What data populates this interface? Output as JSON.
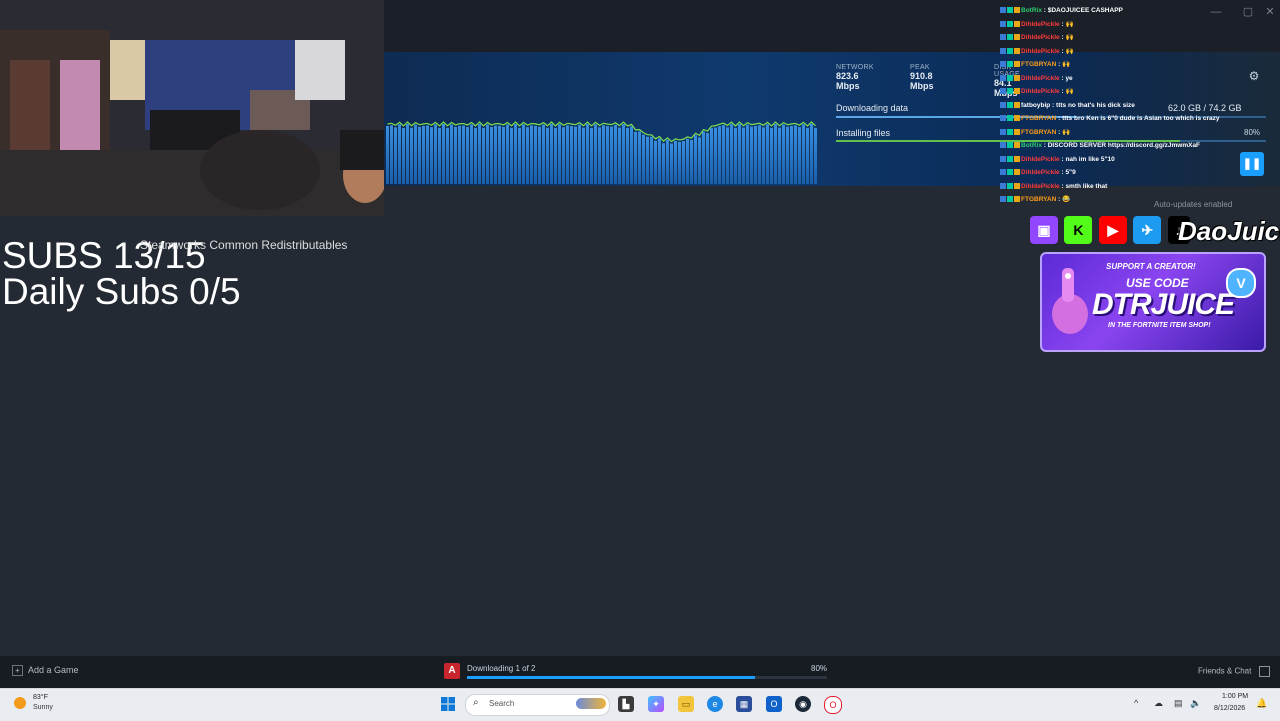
{
  "steam": {
    "network_label": "NETWORK",
    "network_value": "823.6 Mbps",
    "peak_label": "PEAK",
    "peak_value": "910.8 Mbps",
    "disk_label": "DISK USAGE",
    "disk_value": "84.1 Mbps",
    "downloading_label": "Downloading data",
    "installing_label": "Installing files",
    "download_size": "62.0 GB / 74.2 GB",
    "install_percent": "80%",
    "install_progress": 0.8,
    "auto_updates": "Auto-updates enabled",
    "redistributables": "Steamworks Common Redistributables",
    "add_game": "Add a Game",
    "download_status": "Downloading 1 of 2",
    "download_percent": "80%",
    "download_progress": 0.8,
    "friends_chat": "Friends & Chat",
    "pause_icon": "pause-icon",
    "settings_icon": "gear-icon"
  },
  "overlay": {
    "subs": "SUBS 13/15",
    "daily_subs": "Daily Subs  0/5",
    "brand": "DaoJuice",
    "promo_line1": "SUPPORT A CREATOR!",
    "promo_line2": "USE CODE",
    "promo_code": "DTRJUICE",
    "promo_line3": "IN THE FORTNITE ITEM SHOP!"
  },
  "chat": [
    {
      "user": "BotRix",
      "color": "#2ecc71",
      "text": "$DAOJUICEE CASHAPP"
    },
    {
      "user": "DihldePickle",
      "color": "#ff3b3b",
      "text": "🙌"
    },
    {
      "user": "DihldePickle",
      "color": "#ff3b3b",
      "text": "🙌"
    },
    {
      "user": "DihldePickle",
      "color": "#ff3b3b",
      "text": "🙌"
    },
    {
      "user": "FTGBRYAN",
      "color": "#ff9f1a",
      "text": "🙌"
    },
    {
      "user": "DihldePickle",
      "color": "#ff3b3b",
      "text": "ye"
    },
    {
      "user": "DihldePickle",
      "color": "#ff3b3b",
      "text": "🙌"
    },
    {
      "user": "fatboybip",
      "color": "#ffffff",
      "text": "ttts no that's his dick size"
    },
    {
      "user": "FTGBRYAN",
      "color": "#ff9f1a",
      "text": "ttts bro Ken is 6\"0 dude is Asian too which is crazy"
    },
    {
      "user": "FTGBRYAN",
      "color": "#ff9f1a",
      "text": "🙌"
    },
    {
      "user": "BotRix",
      "color": "#2ecc71",
      "text": "DISCORD SERVER https://discord.gg/zJmwmXaF"
    },
    {
      "user": "DihldePickle",
      "color": "#ff3b3b",
      "text": "nah im like 5\"10"
    },
    {
      "user": "DihldePickle",
      "color": "#ff3b3b",
      "text": "5\"9"
    },
    {
      "user": "DihldePickle",
      "color": "#ff3b3b",
      "text": "smth like that"
    },
    {
      "user": "FTGBRYAN",
      "color": "#ff9f1a",
      "text": "😂"
    }
  ],
  "taskbar": {
    "temp": "83°F",
    "condition": "Sunny",
    "search_placeholder": "Search",
    "time": "1:00 PM",
    "date": "8/12/2026"
  }
}
